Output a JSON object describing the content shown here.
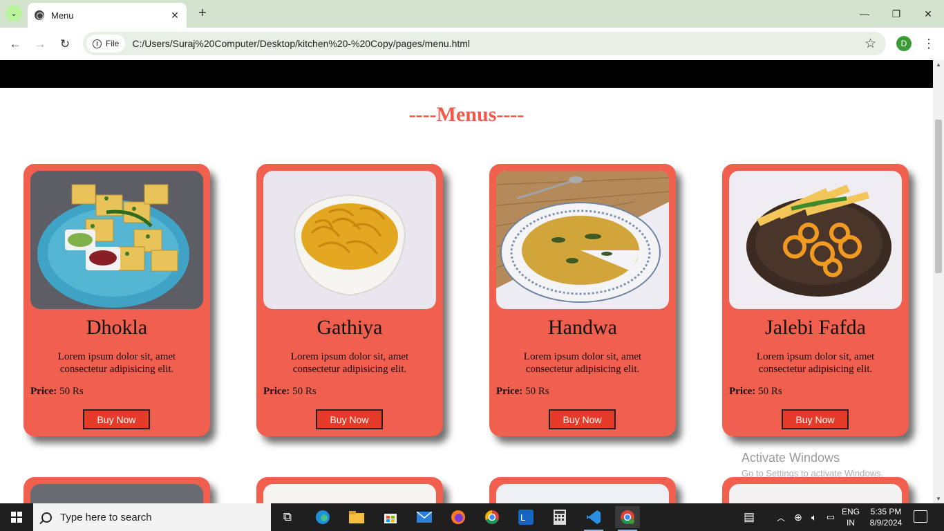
{
  "browser": {
    "tab_title": "Menu",
    "tab_close": "✕",
    "new_tab": "+",
    "window_controls": {
      "minimize": "—",
      "restore": "❐",
      "close": "✕"
    },
    "nav": {
      "back": "←",
      "forward": "→",
      "reload": "↻"
    },
    "file_chip": "File",
    "url": "C:/Users/Suraj%20Computer/Desktop/kitchen%20-%20Copy/pages/menu.html",
    "profile_initial": "D",
    "icons": [
      "tab-search-icon",
      "globe-icon",
      "info-icon",
      "star-icon",
      "kebab-menu-icon"
    ]
  },
  "page": {
    "heading": "----Menus----",
    "accent_color": "#ef5a4a",
    "card_color": "#f15f4e",
    "button_color": "#e63b29",
    "cards": [
      {
        "title": "Dhokla",
        "desc": "Lorem ipsum dolor sit, amet consectetur adipisicing elit.",
        "price_label": "Price:",
        "price_value": "50 Rs",
        "button": "Buy Now"
      },
      {
        "title": "Gathiya",
        "desc": "Lorem ipsum dolor sit, amet consectetur adipisicing elit.",
        "price_label": "Price:",
        "price_value": "50 Rs",
        "button": "Buy Now"
      },
      {
        "title": "Handwa",
        "desc": "Lorem ipsum dolor sit, amet consectetur adipisicing elit.",
        "price_label": "Price:",
        "price_value": "50 Rs",
        "button": "Buy Now"
      },
      {
        "title": "Jalebi Fafda",
        "desc": "Lorem ipsum dolor sit, amet consectetur adipisicing elit.",
        "price_label": "Price:",
        "price_value": "50 Rs",
        "button": "Buy Now"
      }
    ]
  },
  "watermark": {
    "title": "Activate Windows",
    "subtitle": "Go to Settings to activate Windows."
  },
  "taskbar": {
    "search_placeholder": "Type here to search",
    "lang_top": "ENG",
    "lang_bottom": "IN",
    "time": "5:35 PM",
    "date": "8/9/2024"
  }
}
